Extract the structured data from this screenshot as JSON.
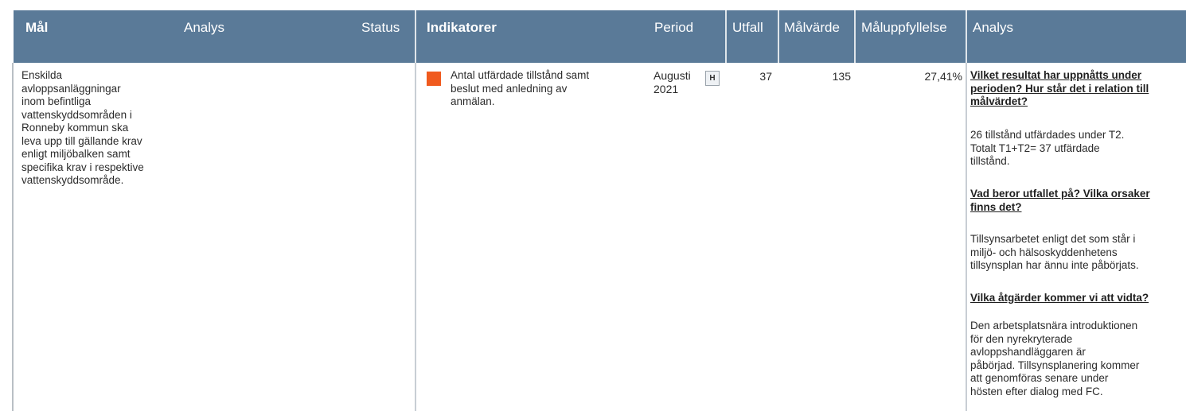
{
  "header": {
    "mal": "Mål",
    "analys_left": "Analys",
    "status": "Status",
    "indikatorer": "Indikatorer",
    "period": "Period",
    "utfall": "Utfall",
    "malvarde": "Målvärde",
    "maluppfyllelse": "Måluppfyllelse",
    "analys_right": "Analys"
  },
  "row": {
    "goal_lines": [
      "Enskilda",
      "avloppsanläggningar",
      "inom befintliga",
      "vattenskyddsområden i",
      "Ronneby kommun ska",
      "leva upp till gällande krav",
      "enligt miljöbalken samt",
      "specifika krav i respektive",
      "vattenskyddsområde."
    ],
    "status_color": "#f05a1e",
    "indicator_lines": [
      "Antal utfärdade tillstånd samt",
      "beslut med anledning av",
      "anmälan."
    ],
    "period_lines": [
      "Augusti",
      "2021"
    ],
    "period_icon": "H",
    "utfall": "37",
    "malvarde": "135",
    "maluppfyllelse": "27,41%",
    "analysis": {
      "q1_lines": [
        "Vilket resultat har uppnåtts under",
        "perioden? Hur står det i relation till",
        "målvärdet?"
      ],
      "a1_lines": [
        "26 tillstånd utfärdades under T2.",
        "Totalt T1+T2= 37 utfärdade",
        "tillstånd."
      ],
      "q2_lines": [
        "Vad beror utfallet på? Vilka orsaker",
        "finns det?"
      ],
      "a2_lines": [
        "Tillsynsarbetet enligt det som står i",
        "miljö- och hälsoskyddenhetens",
        "tillsynsplan har ännu inte påbörjats."
      ],
      "q3_lines": [
        "Vilka åtgärder kommer vi att vidta?"
      ],
      "a3_lines": [
        "Den arbetsplatsnära introduktionen",
        "för den nyrekryterade",
        "avloppshandläggaren är",
        "påbörjad. Tillsynsplanering kommer",
        "att genomföras senare under",
        "hösten efter dialog med FC."
      ]
    }
  }
}
